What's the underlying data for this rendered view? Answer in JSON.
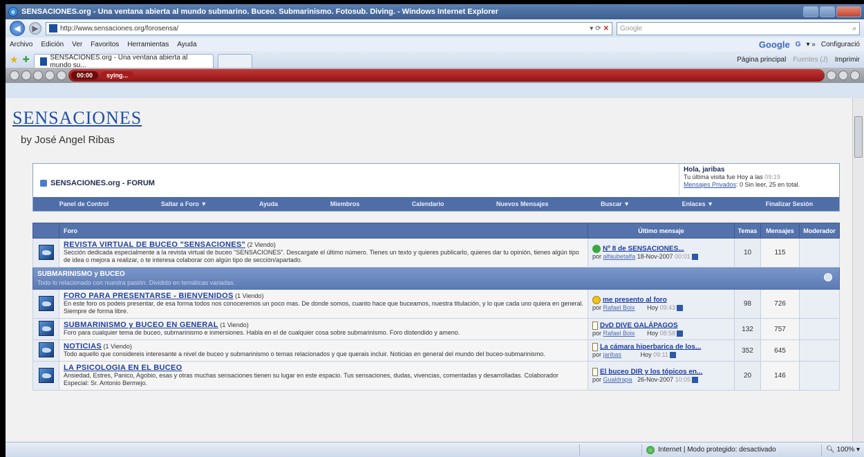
{
  "window": {
    "title": "SENSACIONES.org - Una ventana abierta al mundo submarino. Buceo. Submarinismo. Fotosub. Diving. - Windows Internet Explorer"
  },
  "address": {
    "url": "http://www.sensaciones.org/forosensa/",
    "search_placeholder": "Google"
  },
  "menu": {
    "items": [
      "Archivo",
      "Edición",
      "Ver",
      "Favoritos",
      "Herramientas",
      "Ayuda"
    ],
    "google_label": "Google",
    "google_g": "G",
    "config_label": "Configuració"
  },
  "tabs": {
    "active_tab": "SENSACIONES.org - Una ventana abierta al mundo su...",
    "tools": [
      "Página principal",
      "Fuentes (J)",
      "Imprimir"
    ]
  },
  "media": {
    "time": "00:00",
    "track": "sying..."
  },
  "site": {
    "logo": "SENSACIONES",
    "byline": "by José Angel Ribas"
  },
  "forum_header": {
    "title": "SENSACIONES.org - FORUM",
    "greeting": "Hola, jaribas",
    "last_visit_prefix": "Tu última visita fue Hoy a las",
    "last_visit_time": "09:19",
    "pm_link": "Mensajes Privados",
    "pm_text": ": 0 Sin leer, 25 en total."
  },
  "navbar": [
    "Panel de Control",
    "Saltar a Foro ▼",
    "Ayuda",
    "Miembros",
    "Calendario",
    "Nuevos Mensajes",
    "Buscar ▼",
    "Enlaces ▼",
    "Finalizar Sesión"
  ],
  "table_headers": {
    "forum": "Foro",
    "last_post": "Último mensaje",
    "topics": "Temas",
    "posts": "Mensajes",
    "moderator": "Moderador"
  },
  "forums_top": [
    {
      "name": "REVISTA VIRTUAL DE BUCEO \"SENSACIONES\"",
      "viewing": "(2 Viendo)",
      "desc": "Sección dedicada especialmente a la revista virtual de buceo \"SENSACIONES\". Descargate el último número. Tienes un texto y quieres publicarlo, quieres dar tu opinión, tienes algún tipo de idea o mejora a realizar, o te interesa colaborar con algún tipo de sección/apartado.",
      "last_title": "Nº 8 de SENSACIONES...",
      "last_by_prefix": "por",
      "last_by": "alfaubetalfa",
      "last_date": "18-Nov-2007",
      "last_time": "00:01",
      "topics": "10",
      "posts": "115"
    }
  ],
  "category": {
    "name": "SUBMARINISMO y BUCEO",
    "desc": "Todo lo relacionado con nuestra pasión. Dividido en temáticas variadas."
  },
  "forums": [
    {
      "name": "FORO PARA PRESENTARSE - BIENVENIDOS",
      "viewing": "(1 Viendo)",
      "desc": "En este foro os podeis presentar, de esa forma todos nos conoceremos un poco mas. De donde somos, cuanto hace que buceamos, nuestra titulación, y lo que cada uno quiera en general. Siempre de forma libre.",
      "last_title": "me presento al foro",
      "last_by_prefix": "por",
      "last_by": "Rafael Boix",
      "last_date": "Hoy",
      "last_time": "09:43",
      "topics": "98",
      "posts": "726"
    },
    {
      "name": "SUBMARINISMO y BUCEO EN GENERAL",
      "viewing": "(1 Viendo)",
      "desc": "Foro para cualquier tema de buceo, submarinismo e inmersiones. Habla en el de cualquier cosa sobre submarinismo. Foro distendido y ameno.",
      "last_title": "DvD DIVE GALÁPAGOS",
      "last_by_prefix": "por",
      "last_by": "Rafael Boix",
      "last_date": "Hoy",
      "last_time": "08:58",
      "topics": "132",
      "posts": "757"
    },
    {
      "name": "NOTICIAS",
      "viewing": "(1 Viendo)",
      "desc": "Todo aquello que considereis interesante a nivel de buceo y submarinismo o temas relacionados y que querais incluir. Noticias en general del mundo del buceo-submarinismo.",
      "last_title": "La cámara hiperbarica de los...",
      "last_by_prefix": "por",
      "last_by": "jaribas",
      "last_date": "Hoy",
      "last_time": "09:11",
      "topics": "352",
      "posts": "645"
    },
    {
      "name": "LA PSICOLOGIA EN EL BUCEO",
      "viewing": "",
      "desc": "Ansiedad, Estres, Panico, Agobio, esas y otras muchas sensaciones tienen su lugar en este espacio. Tus sensaciones, dudas, vivencias, comentadas y desarrolladas. Colaborador Especial: Sr. Antonio Bermejo.",
      "last_title": "El buceo DIR y los tópicos en...",
      "last_by_prefix": "por",
      "last_by": "Gualdrapa",
      "last_date": "26-Nov-2007",
      "last_time": "10:05",
      "topics": "20",
      "posts": "146"
    }
  ],
  "status": {
    "zone": "Internet | Modo protegido: desactivado",
    "zoom": "100%"
  }
}
